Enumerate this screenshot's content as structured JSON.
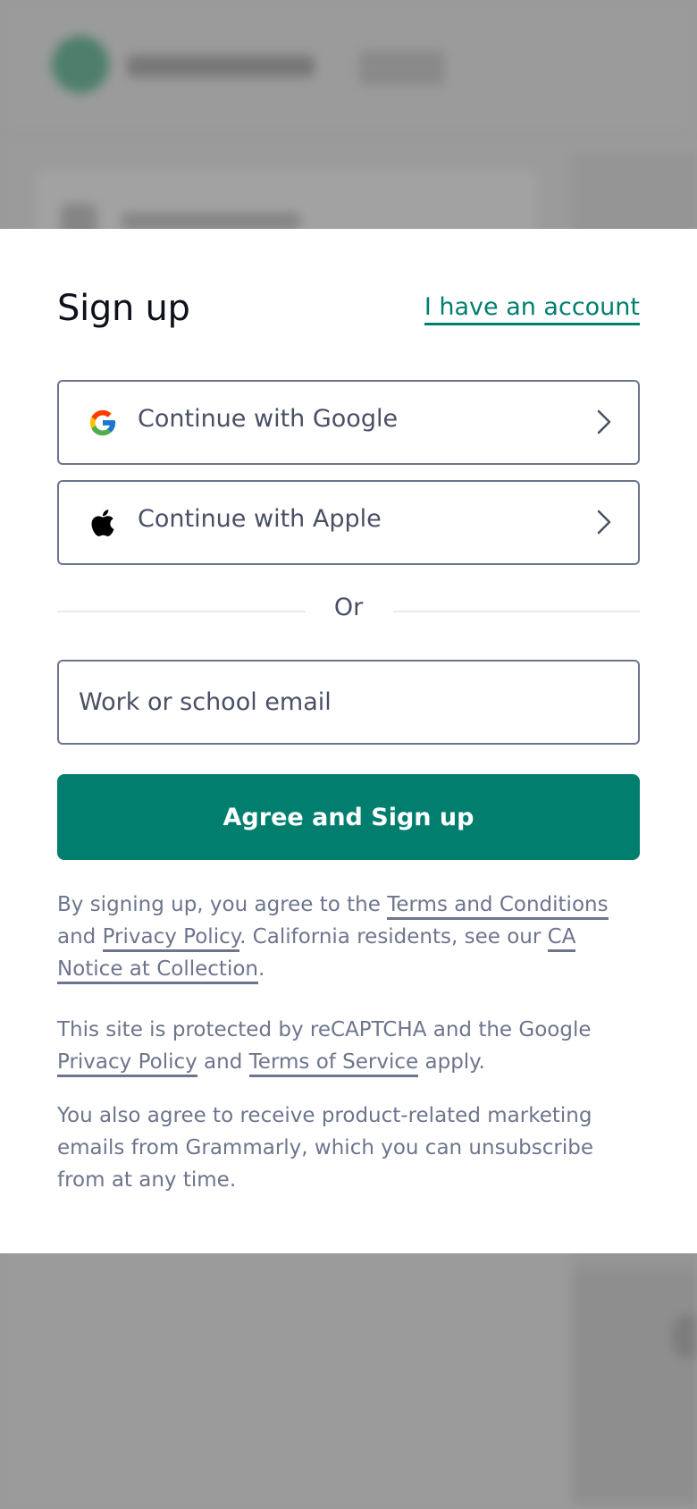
{
  "modal": {
    "title": "Sign up",
    "account_link": "I have an account",
    "google_button": {
      "label": "Continue with Google",
      "icon": "google-icon"
    },
    "apple_button": {
      "label": "Continue with Apple",
      "icon": "apple-icon"
    },
    "divider_text": "Or",
    "email_placeholder": "Work or school email",
    "submit_label": "Agree and Sign up",
    "terms": {
      "prefix": "By signing up, you agree to the ",
      "terms_link": "Terms and Conditions",
      "and1": " and ",
      "privacy_link": "Privacy Policy",
      "middle": ". California residents, see our ",
      "ca_notice_link": "CA Notice at Collection",
      "suffix": "."
    },
    "recaptcha": {
      "prefix": "This site is protected by reCAPTCHA and the Google ",
      "privacy_link": "Privacy Policy",
      "and1": " and ",
      "terms_link": "Terms of Service",
      "suffix": " apply."
    },
    "marketing_text": "You also agree to receive product-related marketing emails from Grammarly, which you can unsubscribe from at any time."
  },
  "colors": {
    "brand": "#027e6f",
    "border": "#6d758d",
    "text": "#4a4f65",
    "overlay": "#9b9b9b"
  }
}
